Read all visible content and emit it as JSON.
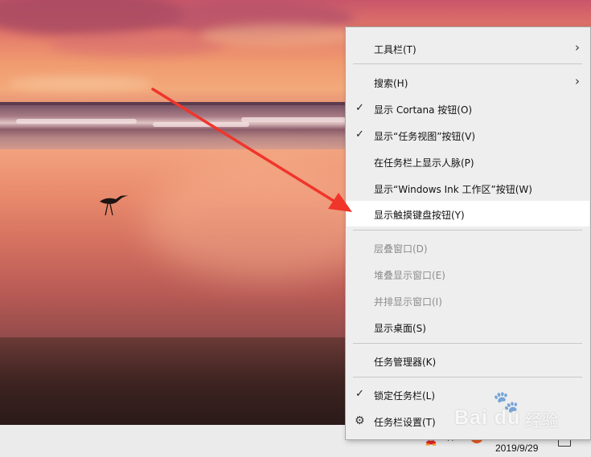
{
  "menu": {
    "items": [
      {
        "label": "工具栏(T)",
        "submenu": true
      },
      {
        "label": "搜索(H)",
        "submenu": true
      },
      {
        "label": "显示 Cortana 按钮(O)",
        "checked": true
      },
      {
        "label": "显示“任务视图”按钮(V)",
        "checked": true
      },
      {
        "label": "在任务栏上显示人脉(P)"
      },
      {
        "label": "显示“Windows Ink 工作区”按钮(W)"
      },
      {
        "label": "显示触摸键盘按钮(Y)",
        "highlighted": true
      },
      {
        "label": "层叠窗口(D)",
        "disabled": true
      },
      {
        "label": "堆叠显示窗口(E)",
        "disabled": true
      },
      {
        "label": "并排显示窗口(I)",
        "disabled": true
      },
      {
        "label": "显示桌面(S)"
      },
      {
        "label": "任务管理器(K)"
      },
      {
        "label": "锁定任务栏(L)",
        "checked": true
      },
      {
        "label": "任务栏设置(T)",
        "icon": "gear-icon"
      }
    ],
    "check_glyph": "✓",
    "chevron_glyph": "›",
    "gear_glyph": "⚙"
  },
  "taskbar": {
    "date": "2019/9/29",
    "tray_icons": [
      "chevron-up-icon",
      "qq-icon",
      "network-icon",
      "sogou-input-icon",
      "notification-icon"
    ]
  },
  "watermark": {
    "brand": "Bai du",
    "sub": "经验",
    "paw": "🐾"
  },
  "colors": {
    "menu_bg": "#eeeeee",
    "menu_hover": "#ffffff",
    "menu_disabled_text": "#8c8c8c",
    "arrow": "#f0352b"
  }
}
